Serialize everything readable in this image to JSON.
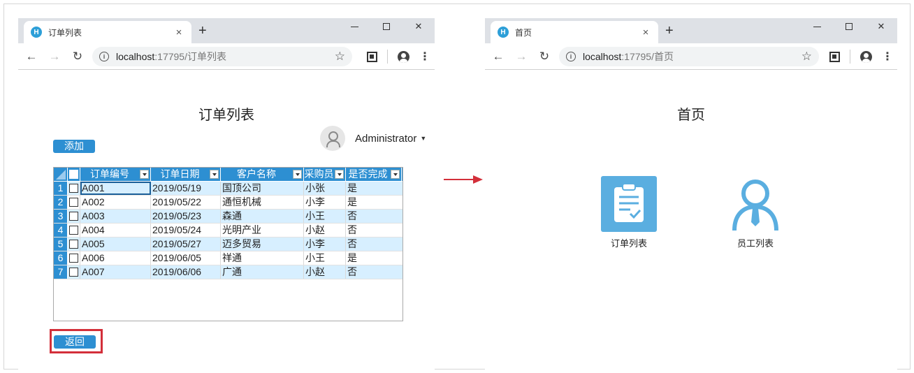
{
  "left_window": {
    "tab_title": "订单列表",
    "favicon_letter": "H",
    "url_host": "localhost",
    "url_path": ":17795/订单列表",
    "page_title": "订单列表",
    "add_button": "添加",
    "back_button": "返回",
    "user_name": "Administrator",
    "grid": {
      "columns": [
        "订单编号",
        "订单日期",
        "客户名称",
        "采购员",
        "是否完成"
      ],
      "rows": [
        {
          "num": "1",
          "id": "A001",
          "date": "2019/05/19",
          "customer": "国顶公司",
          "buyer": "小张",
          "done": "是"
        },
        {
          "num": "2",
          "id": "A002",
          "date": "2019/05/22",
          "customer": "通恒机械",
          "buyer": "小李",
          "done": "是"
        },
        {
          "num": "3",
          "id": "A003",
          "date": "2019/05/23",
          "customer": "森通",
          "buyer": "小王",
          "done": "否"
        },
        {
          "num": "4",
          "id": "A004",
          "date": "2019/05/24",
          "customer": "光明产业",
          "buyer": "小赵",
          "done": "否"
        },
        {
          "num": "5",
          "id": "A005",
          "date": "2019/05/27",
          "customer": "迈多贸易",
          "buyer": "小李",
          "done": "否"
        },
        {
          "num": "6",
          "id": "A006",
          "date": "2019/06/05",
          "customer": "祥通",
          "buyer": "小王",
          "done": "是"
        },
        {
          "num": "7",
          "id": "A007",
          "date": "2019/06/06",
          "customer": "广通",
          "buyer": "小赵",
          "done": "否"
        }
      ]
    }
  },
  "right_window": {
    "tab_title": "首页",
    "favicon_letter": "H",
    "url_host": "localhost",
    "url_path": ":17795/首页",
    "page_title": "首页",
    "tiles": [
      {
        "label": "订单列表",
        "icon": "clipboard-icon"
      },
      {
        "label": "员工列表",
        "icon": "employee-icon"
      }
    ]
  },
  "colors": {
    "accent_blue": "#2d8fd2",
    "row_alt": "#d7efff",
    "highlight_red": "#d32f3a",
    "tile_blue": "#5aaee0"
  },
  "icons": {
    "new_tab": "+",
    "close": "×",
    "back": "←",
    "forward": "→",
    "reload": "↻",
    "star": "☆",
    "menu": "⋮",
    "info": "i",
    "win_close": "✕",
    "caret": "▼"
  }
}
